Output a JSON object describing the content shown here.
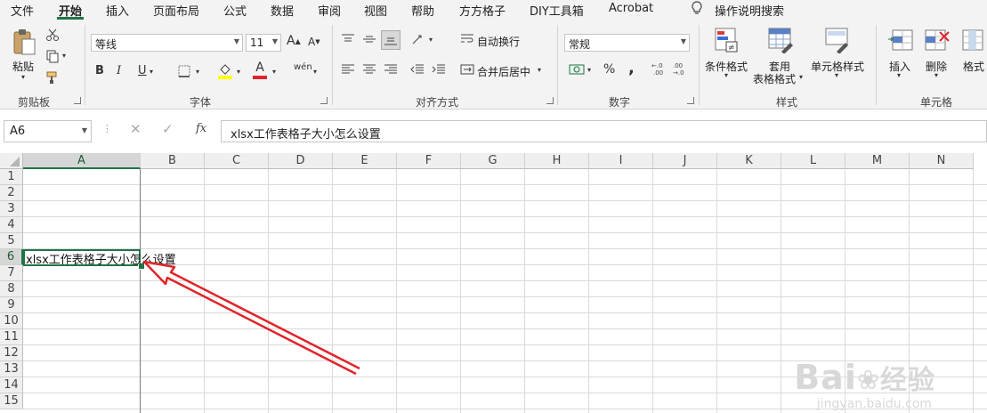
{
  "menu": {
    "items": [
      "文件",
      "开始",
      "插入",
      "页面布局",
      "公式",
      "数据",
      "审阅",
      "视图",
      "帮助",
      "方方格子",
      "DIY工具箱",
      "Acrobat"
    ],
    "tell_me": "操作说明搜索",
    "tell_me_icon": "lightbulb-icon"
  },
  "ribbon": {
    "clipboard": {
      "paste": "粘贴",
      "label": "剪贴板"
    },
    "font": {
      "family": "等线",
      "size": "11",
      "label": "字体",
      "bold": "B",
      "italic": "I",
      "underline": "U",
      "grow": "A",
      "shrink": "A",
      "font_color": "A",
      "phonetic": "wén"
    },
    "alignment": {
      "wrap": "自动换行",
      "merge": "合并后居中",
      "label": "对齐方式"
    },
    "number": {
      "format": "常规",
      "percent": "%",
      "comma": ",",
      "label": "数字"
    },
    "styles": {
      "conditional": "条件格式",
      "table_format_1": "套用",
      "table_format_2": "表格格式",
      "cell_styles": "单元格样式",
      "label": "样式"
    },
    "cells": {
      "insert": "插入",
      "delete": "删除",
      "format": "格式",
      "label": "单元格"
    }
  },
  "formula_bar": {
    "name_box": "A6",
    "fx": "fx",
    "content": "xlsx工作表格子大小怎么设置"
  },
  "grid": {
    "columns": [
      "A",
      "B",
      "C",
      "D",
      "E",
      "F",
      "G",
      "H",
      "I",
      "J",
      "K",
      "L",
      "M",
      "N"
    ],
    "rows": [
      "1",
      "2",
      "3",
      "4",
      "5",
      "6",
      "7",
      "8",
      "9",
      "10",
      "11",
      "12",
      "13",
      "14",
      "15"
    ],
    "selected_column": "A",
    "selected_row": "6",
    "cell_a6": "xlsx工作表格子大小怎么设置"
  },
  "watermark": {
    "logo": "Bai",
    "logo2": "经验",
    "url": "jingyan.baidu.com"
  },
  "colors": {
    "accent": "#217346",
    "arrow": "#e0242a",
    "font_color_bar": "#e0242a",
    "fill_bar": "#ffff00"
  }
}
